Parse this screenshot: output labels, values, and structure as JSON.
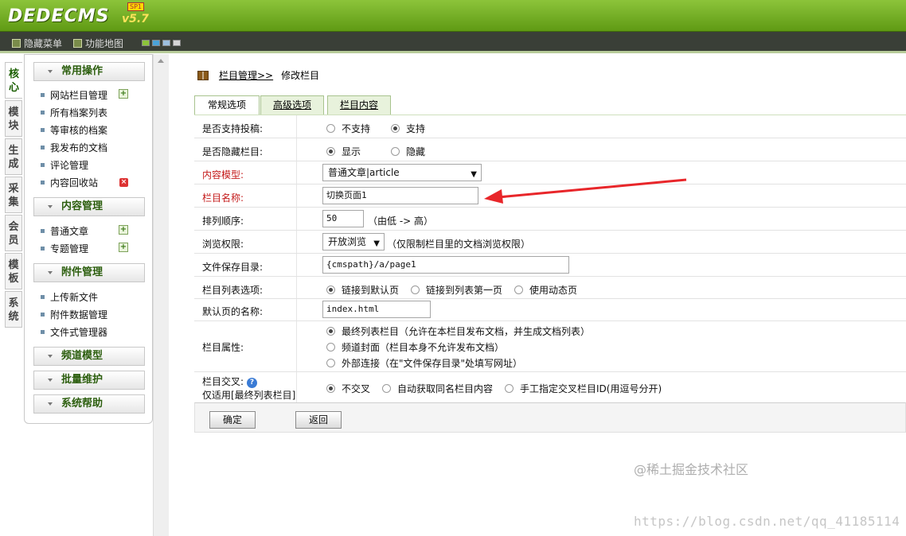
{
  "brand": {
    "logo": "DEDECMS",
    "version": "v5.7",
    "sp": "SP1"
  },
  "toolbar": {
    "hide_menu": "隐藏菜单",
    "site_map": "功能地图",
    "swatches": [
      "#8cc43a",
      "#4aa3d8",
      "#9dbfdf",
      "#d6d6d6"
    ]
  },
  "vtabs": [
    "核心",
    "模块",
    "生成",
    "采集",
    "会员",
    "模板",
    "系统"
  ],
  "sidebar": {
    "sections": [
      {
        "title": "常用操作",
        "items": [
          "网站栏目管理",
          "所有档案列表",
          "等审核的档案",
          "我发布的文档",
          "评论管理",
          "内容回收站"
        ]
      },
      {
        "title": "内容管理",
        "items": [
          "普通文章",
          "专题管理"
        ]
      },
      {
        "title": "附件管理",
        "items": [
          "上传新文件",
          "附件数据管理",
          "文件式管理器"
        ]
      },
      {
        "title": "频道模型",
        "items": []
      },
      {
        "title": "批量维护",
        "items": []
      },
      {
        "title": "系统帮助",
        "items": []
      }
    ]
  },
  "breadcrumb": {
    "parent": "栏目管理>>",
    "current": "修改栏目"
  },
  "tabs": [
    "常规选项",
    "高级选项",
    "栏目内容"
  ],
  "form": {
    "allow_post": {
      "label": "是否支持投稿:",
      "opt1": "不支持",
      "opt2": "支持"
    },
    "hidden": {
      "label": "是否隐藏栏目:",
      "opt1": "显示",
      "opt2": "隐藏"
    },
    "model": {
      "label": "内容模型:",
      "value": "普通文章|article"
    },
    "name": {
      "label": "栏目名称:",
      "value": "切换页面1"
    },
    "order": {
      "label": "排列顺序:",
      "value": "50",
      "hint": "（由低 -> 高）"
    },
    "access": {
      "label": "浏览权限:",
      "value": "开放浏览",
      "hint": "（仅限制栏目里的文档浏览权限）"
    },
    "dir": {
      "label": "文件保存目录:",
      "value": "{cmspath}/a/page1"
    },
    "list_opt": {
      "label": "栏目列表选项:",
      "opt1": "链接到默认页",
      "opt2": "链接到列表第一页",
      "opt3": "使用动态页"
    },
    "default_page": {
      "label": "默认页的名称:",
      "value": "index.html"
    },
    "attr": {
      "label": "栏目属性:",
      "opt1": "最终列表栏目（允许在本栏目发布文档，并生成文档列表）",
      "opt2": "频道封面（栏目本身不允许发布文档）",
      "opt3": "外部连接（在\"文件保存目录\"处填写网址）"
    },
    "cross": {
      "label": "栏目交叉:",
      "label2": "仅适用[最终列表栏目]",
      "help": "?",
      "opt1": "不交叉",
      "opt2": "自动获取同名栏目内容",
      "opt3": "手工指定交叉栏目ID(用逗号分开)"
    }
  },
  "buttons": {
    "ok": "确定",
    "back": "返回"
  },
  "watermark": {
    "text": "@稀土掘金技术社区",
    "url": "https://blog.csdn.net/qq_41185114"
  }
}
